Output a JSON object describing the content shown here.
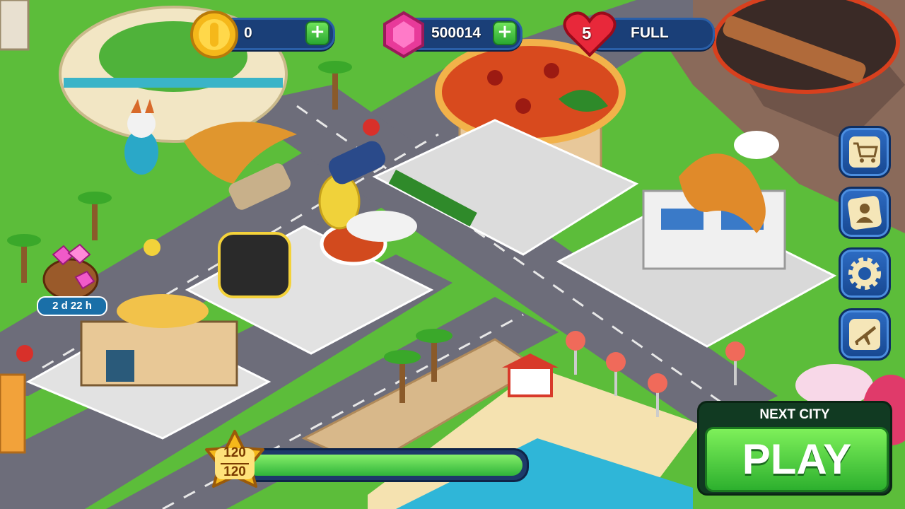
{
  "hud": {
    "coins": {
      "value": "0",
      "icon": "coin-icon"
    },
    "gems": {
      "value": "500014",
      "icon": "gem-icon"
    },
    "lives": {
      "count": "5",
      "status": "FULL",
      "icon": "heart-icon"
    }
  },
  "side_menu": [
    {
      "id": "shop",
      "icon": "shopping-cart-icon"
    },
    {
      "id": "profile",
      "icon": "profile-card-icon"
    },
    {
      "id": "settings",
      "icon": "gear-icon"
    },
    {
      "id": "travel",
      "icon": "airplane-icon"
    }
  ],
  "gem_pot": {
    "timer": "2 d 22 h",
    "icon": "gem-pot-icon"
  },
  "level": {
    "current": "120",
    "max": "120",
    "progress": 1.0
  },
  "next_city": {
    "label": "NEXT CITY",
    "button": "PLAY"
  },
  "colors": {
    "hud_blue": "#1a3f78",
    "play_green": "#2db02e",
    "road": "#6d6d7a",
    "grass": "#5cbd3a"
  }
}
